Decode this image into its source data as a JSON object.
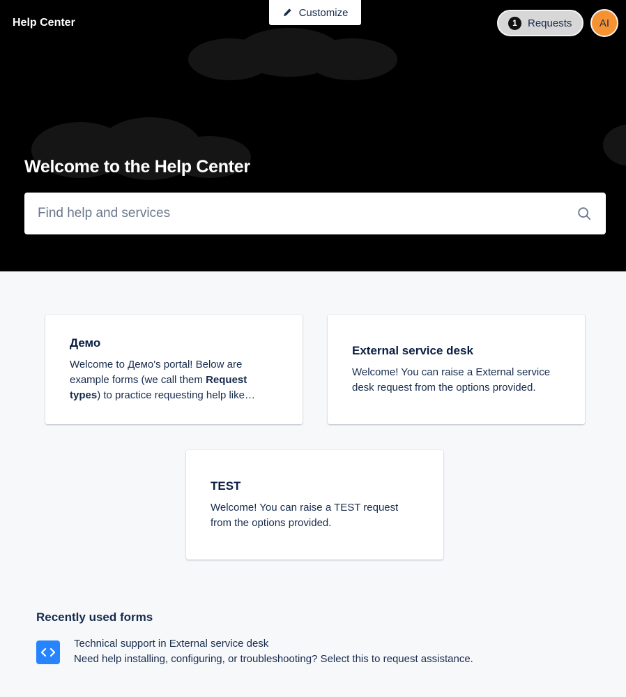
{
  "header": {
    "brand": "Help Center",
    "customize_label": "Customize",
    "requests_label": "Requests",
    "requests_count": "1",
    "avatar_initials": "AI"
  },
  "hero": {
    "title": "Welcome to the Help Center",
    "search_placeholder": "Find help and services"
  },
  "portals": [
    {
      "title": "Демо",
      "desc_before": "Welcome to Демо's portal! Below are example forms (we call them ",
      "desc_bold": "Request types",
      "desc_after": ") to practice requesting help like…"
    },
    {
      "title": "External service desk",
      "desc": "Welcome! You can raise a External service desk request from the options provided."
    },
    {
      "title": "TEST",
      "desc": "Welcome! You can raise a TEST request from the options provided."
    }
  ],
  "recent": {
    "heading": "Recently used forms",
    "items": [
      {
        "icon": "code-icon",
        "title": "Technical support in External service desk",
        "description": "Need help installing, configuring, or troubleshooting? Select this to request assistance."
      }
    ]
  },
  "colors": {
    "hero_bg": "#000000",
    "page_bg": "#f7f8fa",
    "avatar": "#f79232",
    "form_icon": "#2684ff"
  }
}
